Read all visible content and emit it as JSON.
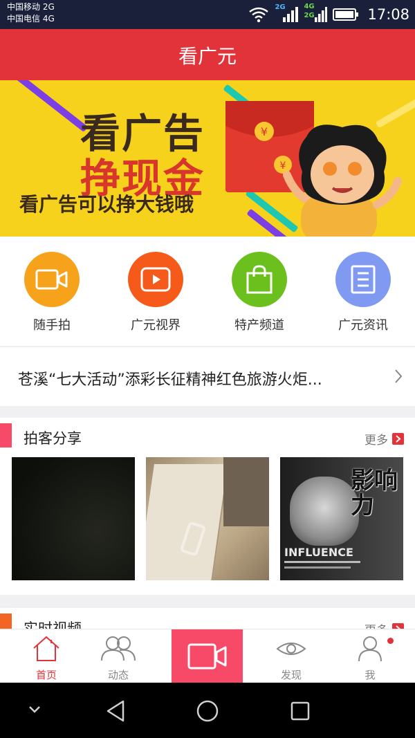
{
  "status_bar": {
    "carrier1": "中国移动 2G",
    "carrier2": "中国电信 4G",
    "net1": "2G",
    "net2a": "4G",
    "net2b": "2G",
    "time": "17:08"
  },
  "header": {
    "title": "看广元"
  },
  "banner": {
    "line1": "看广告",
    "line2": "挣现金",
    "line3": "看广告可以挣大钱哦"
  },
  "menu": [
    {
      "label": "随手拍",
      "icon": "camera-icon",
      "color": "#f7a21b"
    },
    {
      "label": "广元视界",
      "icon": "play-icon",
      "color": "#f65a1a"
    },
    {
      "label": "特产频道",
      "icon": "shopping-bag-icon",
      "color": "#6cc01e"
    },
    {
      "label": "广元资讯",
      "icon": "news-list-icon",
      "color": "#7f9af0"
    }
  ],
  "news": {
    "headline": "苍溪“七大活动”添彩长征精神红色旅游火炬..."
  },
  "sections": {
    "paike": {
      "title": "拍客分享",
      "more": "更多",
      "accent": "#f64a68"
    },
    "video": {
      "title": "实时视频",
      "more": "更多",
      "accent": "#f26522"
    }
  },
  "thumbnails": {
    "book_title": "影响力",
    "book_subtitle": "INFLUENCE"
  },
  "tabbar": [
    {
      "label": "首页",
      "icon": "home-icon",
      "active": true
    },
    {
      "label": "动态",
      "icon": "people-icon",
      "active": false
    },
    {
      "label": "",
      "icon": "video-record-icon",
      "active": false
    },
    {
      "label": "发现",
      "icon": "eye-icon",
      "active": false
    },
    {
      "label": "我",
      "icon": "user-icon",
      "active": false
    }
  ]
}
